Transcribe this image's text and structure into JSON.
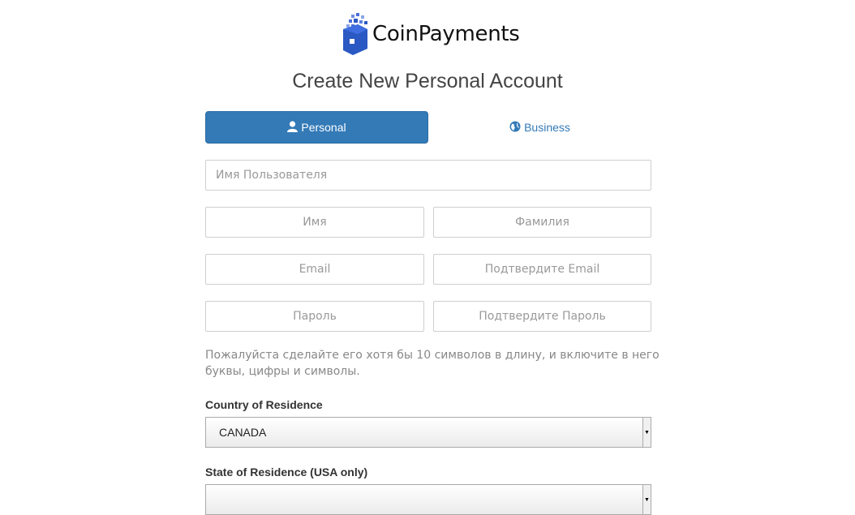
{
  "brand": {
    "name": "CoinPayments"
  },
  "page": {
    "title": "Create New Personal Account"
  },
  "tabs": {
    "personal": "Personal",
    "business": "Business"
  },
  "form": {
    "username_placeholder": "Имя Пользователя",
    "first_name_placeholder": "Имя",
    "last_name_placeholder": "Фамилия",
    "email_placeholder": "Email",
    "confirm_email_placeholder": "Подтвердите Email",
    "password_placeholder": "Пароль",
    "confirm_password_placeholder": "Подтвердите Пароль",
    "password_hint_line1": "Пожалуйста сделайте его хотя бы 10 символов в длину, и включите в него",
    "password_hint_line2": "буквы, цифры и символы.",
    "country_label": "Country of Residence",
    "country_value": "CANADA",
    "state_label": "State of Residence (USA only)",
    "state_value": ""
  },
  "icons": {
    "personal": "user-icon",
    "business": "globe-icon",
    "logo": "wallet-logo-icon"
  },
  "colors": {
    "primary": "#337ab7",
    "logo_blue": "#2b59c3"
  }
}
